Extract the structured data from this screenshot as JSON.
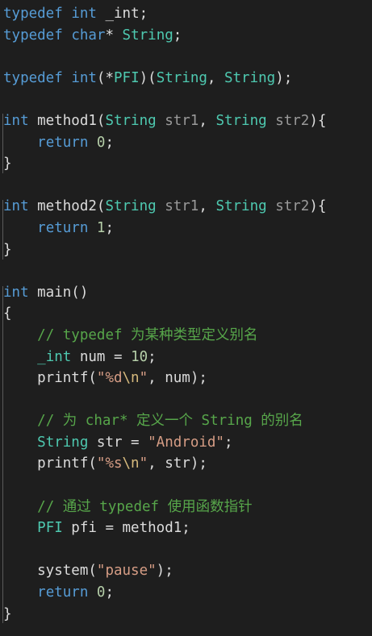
{
  "colors": {
    "background": "#1e1e1e",
    "keyword": "#569cd6",
    "type": "#4ec9b0",
    "plain": "#dcdcdc",
    "parameter": "#9a9a9a",
    "number": "#b5cea8",
    "string": "#d69d85",
    "comment": "#57a64a"
  },
  "code_lines": [
    [
      [
        "kw",
        "typedef"
      ],
      [
        "plain",
        " "
      ],
      [
        "kw",
        "int"
      ],
      [
        "plain",
        " _int;"
      ]
    ],
    [
      [
        "kw",
        "typedef"
      ],
      [
        "plain",
        " "
      ],
      [
        "kw",
        "char"
      ],
      [
        "plain",
        "* "
      ],
      [
        "type",
        "String"
      ],
      [
        "plain",
        ";"
      ]
    ],
    [],
    [
      [
        "kw",
        "typedef"
      ],
      [
        "plain",
        " "
      ],
      [
        "kw",
        "int"
      ],
      [
        "plain",
        "(*"
      ],
      [
        "type",
        "PFI"
      ],
      [
        "plain",
        ")("
      ],
      [
        "type",
        "String"
      ],
      [
        "plain",
        ", "
      ],
      [
        "type",
        "String"
      ],
      [
        "plain",
        ");"
      ]
    ],
    [],
    [
      [
        "kw",
        "int"
      ],
      [
        "plain",
        " method1("
      ],
      [
        "type",
        "String"
      ],
      [
        "plain",
        " "
      ],
      [
        "param",
        "str1"
      ],
      [
        "plain",
        ", "
      ],
      [
        "type",
        "String"
      ],
      [
        "plain",
        " "
      ],
      [
        "param",
        "str2"
      ],
      [
        "plain",
        "){"
      ]
    ],
    [
      [
        "plain",
        "    "
      ],
      [
        "kw",
        "return"
      ],
      [
        "plain",
        " "
      ],
      [
        "num",
        "0"
      ],
      [
        "plain",
        ";"
      ]
    ],
    [
      [
        "plain",
        "}"
      ]
    ],
    [],
    [
      [
        "kw",
        "int"
      ],
      [
        "plain",
        " method2("
      ],
      [
        "type",
        "String"
      ],
      [
        "plain",
        " "
      ],
      [
        "param",
        "str1"
      ],
      [
        "plain",
        ", "
      ],
      [
        "type",
        "String"
      ],
      [
        "plain",
        " "
      ],
      [
        "param",
        "str2"
      ],
      [
        "plain",
        "){"
      ]
    ],
    [
      [
        "plain",
        "    "
      ],
      [
        "kw",
        "return"
      ],
      [
        "plain",
        " "
      ],
      [
        "num",
        "1"
      ],
      [
        "plain",
        ";"
      ]
    ],
    [
      [
        "plain",
        "}"
      ]
    ],
    [],
    [
      [
        "kw",
        "int"
      ],
      [
        "plain",
        " main()"
      ]
    ],
    [
      [
        "plain",
        "{"
      ]
    ],
    [
      [
        "plain",
        "    "
      ],
      [
        "comment",
        "// typedef 为某种类型定义别名"
      ]
    ],
    [
      [
        "plain",
        "    "
      ],
      [
        "type",
        "_int"
      ],
      [
        "plain",
        " num = "
      ],
      [
        "num",
        "10"
      ],
      [
        "plain",
        ";"
      ]
    ],
    [
      [
        "plain",
        "    printf("
      ],
      [
        "str",
        "\"%d"
      ],
      [
        "esc",
        "\\n"
      ],
      [
        "str",
        "\""
      ],
      [
        "plain",
        ", num);"
      ]
    ],
    [],
    [
      [
        "plain",
        "    "
      ],
      [
        "comment",
        "// 为 char* 定义一个 String 的别名"
      ]
    ],
    [
      [
        "plain",
        "    "
      ],
      [
        "type",
        "String"
      ],
      [
        "plain",
        " str = "
      ],
      [
        "str",
        "\"Android\""
      ],
      [
        "plain",
        ";"
      ]
    ],
    [
      [
        "plain",
        "    printf("
      ],
      [
        "str",
        "\"%s"
      ],
      [
        "esc",
        "\\n"
      ],
      [
        "str",
        "\""
      ],
      [
        "plain",
        ", str);"
      ]
    ],
    [],
    [
      [
        "plain",
        "    "
      ],
      [
        "comment",
        "// 通过 typedef 使用函数指针"
      ]
    ],
    [
      [
        "plain",
        "    "
      ],
      [
        "type",
        "PFI"
      ],
      [
        "plain",
        " pfi = method1;"
      ]
    ],
    [],
    [
      [
        "plain",
        "    system("
      ],
      [
        "str",
        "\"pause\""
      ],
      [
        "plain",
        ");"
      ]
    ],
    [
      [
        "plain",
        "    "
      ],
      [
        "kw",
        "return"
      ],
      [
        "plain",
        " "
      ],
      [
        "num",
        "0"
      ],
      [
        "plain",
        ";"
      ]
    ],
    [
      [
        "plain",
        "}"
      ]
    ]
  ]
}
